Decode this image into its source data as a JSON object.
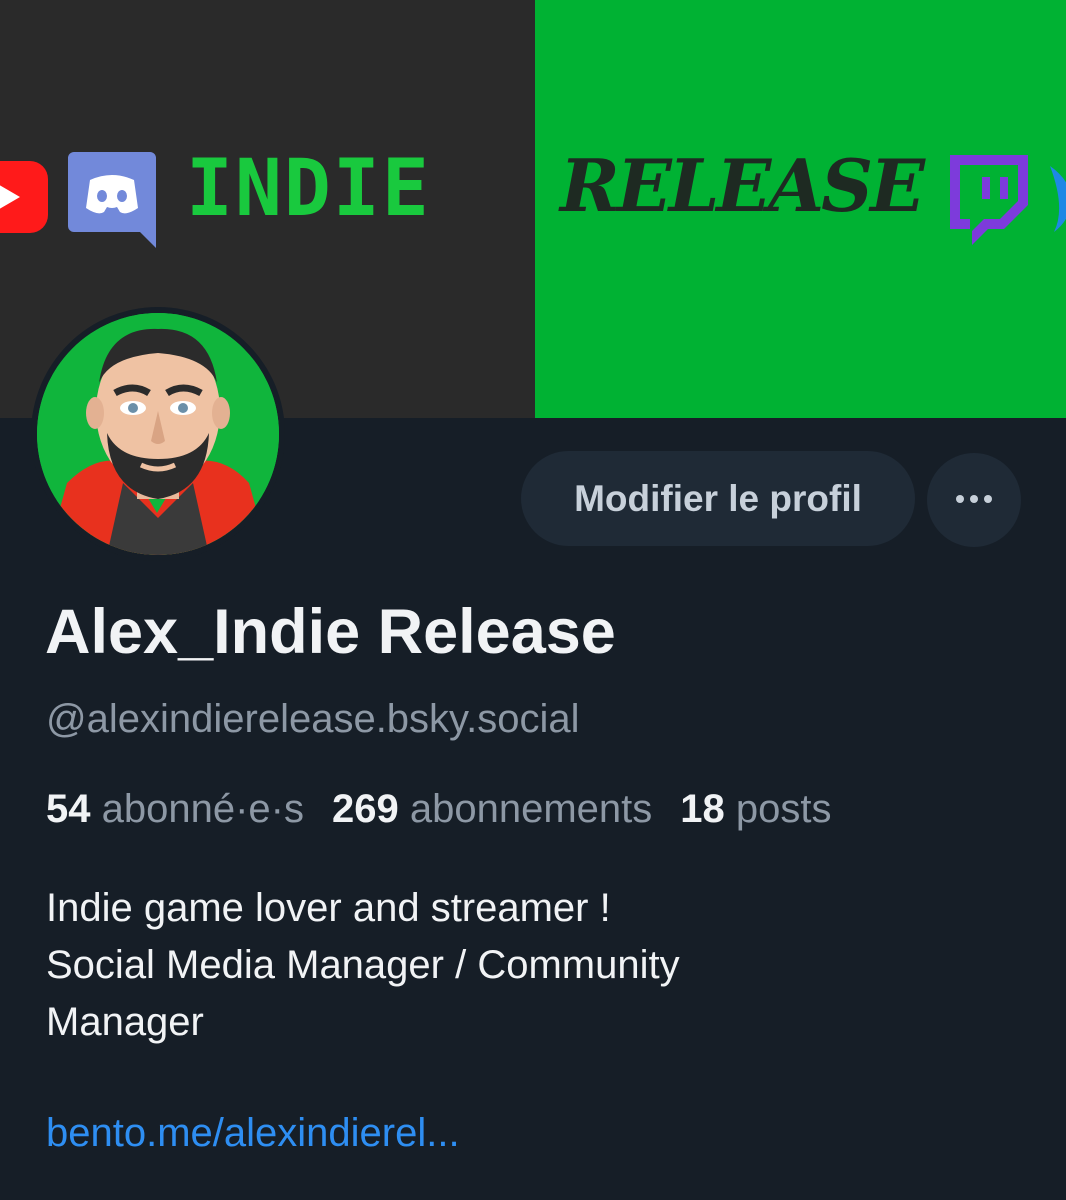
{
  "banner": {
    "left_word": "INDIE",
    "right_word": "RELEASE",
    "colors": {
      "left_bg": "#2a2a2a",
      "right_bg": "#00b233",
      "indie_text": "#19c93e",
      "release_text": "#1e2a22"
    },
    "icons": [
      "youtube-icon",
      "discord-icon",
      "twitch-icon",
      "bluesky-icon"
    ]
  },
  "avatar": {
    "alt": "cartoon avatar of a bearded man"
  },
  "actions": {
    "edit_label": "Modifier le profil",
    "more_icon": "ellipsis-icon"
  },
  "profile": {
    "display_name": "Alex_Indie Release",
    "handle": "@alexindierelease.bsky.social"
  },
  "stats": {
    "followers_count": "54",
    "followers_label": "abonné·e·s",
    "following_count": "269",
    "following_label": "abonnements",
    "posts_count": "18",
    "posts_label": "posts"
  },
  "bio": {
    "lines": [
      "Indie game lover and streamer !",
      "Social Media Manager / Community",
      "Manager"
    ]
  },
  "link": {
    "text": "bento.me/alexindierel..."
  },
  "colors": {
    "page_bg": "#161e27",
    "button_bg": "#1f2a36",
    "muted_text": "#8d98a5",
    "link": "#2e8ef2"
  }
}
